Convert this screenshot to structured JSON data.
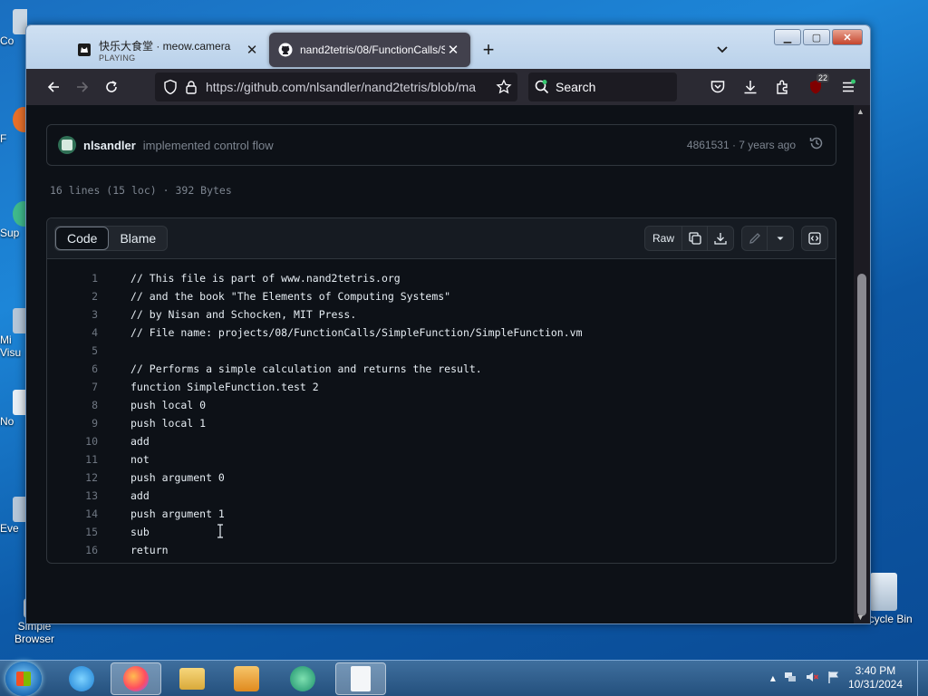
{
  "desktop": {
    "icons_left_partial": [
      "Co",
      "F",
      "Sup",
      "Mi",
      "Visu",
      "No",
      "Eve"
    ],
    "simple_browser_label": "Simple Browser",
    "recycle_bin_label": "Recycle Bin"
  },
  "browser": {
    "tabs": [
      {
        "title": "快乐大食堂 · meow.camera",
        "subtitle": "PLAYING",
        "active": false
      },
      {
        "title": "nand2tetris/08/FunctionCalls/S",
        "subtitle": "",
        "active": true
      }
    ],
    "new_tab_label": "+",
    "url": "https://github.com/nlsandler/nand2tetris/blob/ma",
    "search_placeholder": "Search",
    "extension_badge": "22"
  },
  "page": {
    "commit": {
      "author": "nlsandler",
      "message": "implemented control flow",
      "sha_age": "4861531 · 7 years ago"
    },
    "file_info": "16 lines (15 loc) · 392 Bytes",
    "view_tabs": [
      "Code",
      "Blame"
    ],
    "raw_label": "Raw",
    "code_lines": [
      {
        "n": "1",
        "text": "// This file is part of www.nand2tetris.org"
      },
      {
        "n": "2",
        "text": "// and the book \"The Elements of Computing Systems\""
      },
      {
        "n": "3",
        "text": "// by Nisan and Schocken, MIT Press."
      },
      {
        "n": "4",
        "text": "// File name: projects/08/FunctionCalls/SimpleFunction/SimpleFunction.vm"
      },
      {
        "n": "5",
        "text": ""
      },
      {
        "n": "6",
        "text": "// Performs a simple calculation and returns the result."
      },
      {
        "n": "7",
        "text": "function SimpleFunction.test 2"
      },
      {
        "n": "8",
        "text": "push local 0"
      },
      {
        "n": "9",
        "text": "push local 1"
      },
      {
        "n": "10",
        "text": "add"
      },
      {
        "n": "11",
        "text": "not"
      },
      {
        "n": "12",
        "text": "push argument 0"
      },
      {
        "n": "13",
        "text": "add"
      },
      {
        "n": "14",
        "text": "push argument 1"
      },
      {
        "n": "15",
        "text": "sub"
      },
      {
        "n": "16",
        "text": "return"
      }
    ]
  },
  "taskbar": {
    "time": "3:40 PM",
    "date": "10/31/2024"
  }
}
